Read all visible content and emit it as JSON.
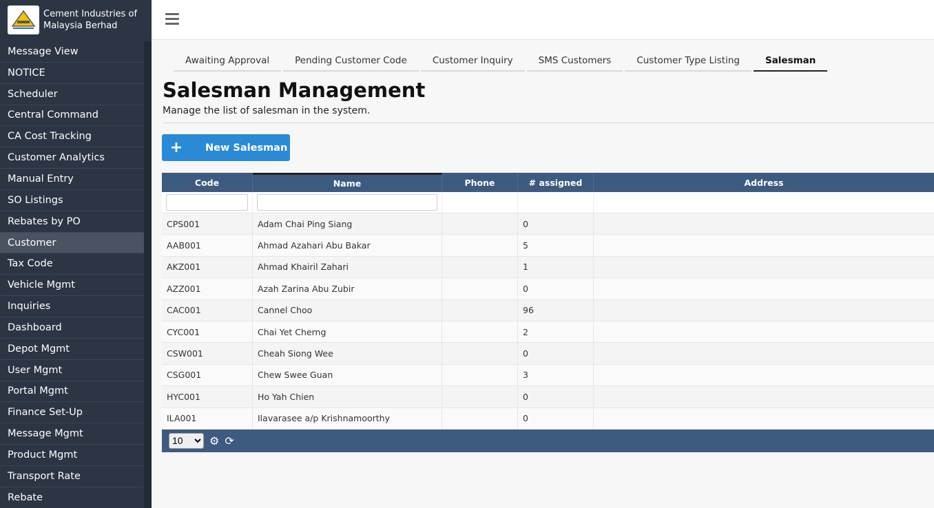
{
  "brand": {
    "name_line1": "Cement Industries of",
    "name_line2": "Malaysia Berhad"
  },
  "sidebar": {
    "items": [
      {
        "label": "Message View"
      },
      {
        "label": "NOTICE"
      },
      {
        "label": "Scheduler"
      },
      {
        "label": "Central Command"
      },
      {
        "label": "CA Cost Tracking"
      },
      {
        "label": "Customer Analytics"
      },
      {
        "label": "Manual Entry"
      },
      {
        "label": "SO Listings"
      },
      {
        "label": "Rebates by PO"
      },
      {
        "label": "Customer",
        "active": true
      },
      {
        "label": "Tax Code"
      },
      {
        "label": "Vehicle Mgmt"
      },
      {
        "label": "Inquiries"
      },
      {
        "label": "Dashboard"
      },
      {
        "label": "Depot Mgmt"
      },
      {
        "label": "User Mgmt"
      },
      {
        "label": "Portal Mgmt"
      },
      {
        "label": "Finance Set-Up"
      },
      {
        "label": "Message Mgmt"
      },
      {
        "label": "Product Mgmt"
      },
      {
        "label": "Transport Rate"
      },
      {
        "label": "Rebate"
      }
    ]
  },
  "tabs": [
    {
      "label": "Awaiting Approval"
    },
    {
      "label": "Pending Customer Code"
    },
    {
      "label": "Customer Inquiry"
    },
    {
      "label": "SMS Customers"
    },
    {
      "label": "Customer Type Listing"
    },
    {
      "label": "Salesman",
      "active": true
    }
  ],
  "page": {
    "title": "Salesman Management",
    "subtitle": "Manage the list of salesman in the system."
  },
  "new_button": {
    "icon": "plus-icon",
    "label": "New Salesman"
  },
  "table": {
    "columns": [
      "Code",
      "Name",
      "Phone",
      "# assigned",
      "Address"
    ],
    "rows": [
      {
        "code": "CPS001",
        "name": "Adam Chai Ping Siang",
        "phone": "",
        "assigned": "0",
        "address": ""
      },
      {
        "code": "AAB001",
        "name": "Ahmad Azahari Abu Bakar",
        "phone": "",
        "assigned": "5",
        "address": ""
      },
      {
        "code": "AKZ001",
        "name": "Ahmad Khairil Zahari",
        "phone": "",
        "assigned": "1",
        "address": ""
      },
      {
        "code": "AZZ001",
        "name": "Azah Zarina Abu Zubir",
        "phone": "",
        "assigned": "0",
        "address": ""
      },
      {
        "code": "CAC001",
        "name": "Cannel Choo",
        "phone": "",
        "assigned": "96",
        "address": ""
      },
      {
        "code": "CYC001",
        "name": "Chai Yet Cherng",
        "phone": "",
        "assigned": "2",
        "address": ""
      },
      {
        "code": "CSW001",
        "name": "Cheah Siong Wee",
        "phone": "",
        "assigned": "0",
        "address": ""
      },
      {
        "code": "CSG001",
        "name": "Chew Swee Guan",
        "phone": "",
        "assigned": "3",
        "address": ""
      },
      {
        "code": "HYC001",
        "name": "Ho Yah Chien",
        "phone": "",
        "assigned": "0",
        "address": ""
      },
      {
        "code": "ILA001",
        "name": "Ilavarasee a/p Krishnamoorthy",
        "phone": "",
        "assigned": "0",
        "address": ""
      }
    ],
    "page_size": "10",
    "footer_icons": [
      "gear-icon",
      "refresh-icon"
    ]
  },
  "colors": {
    "sidebar": "#2b3544",
    "accent": "#2a8ad6",
    "grid_header": "#3d5a80"
  }
}
